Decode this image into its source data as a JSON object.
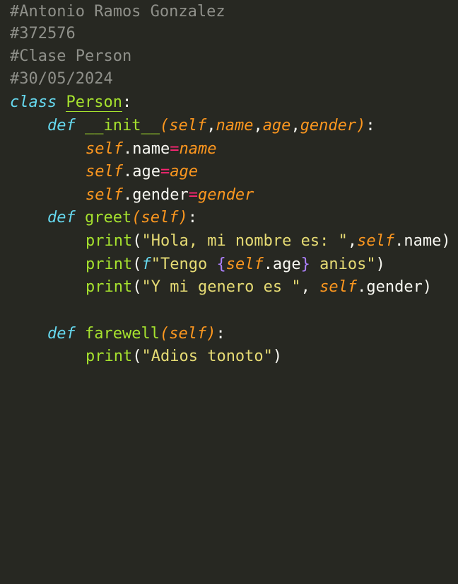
{
  "lines": {
    "l1": {
      "c": "#Antonio Ramos Gonzalez"
    },
    "l2": {
      "c": "#372576"
    },
    "l3": {
      "c": "#Clase Person"
    },
    "l4": {
      "c": "#30/05/2024"
    },
    "l5": {
      "kw": "class",
      "sp": " ",
      "name": "Person",
      "colon": ":"
    },
    "l6": {
      "kw": "def",
      "sp": " ",
      "fn": "__init__",
      "p1": "(",
      "self": "self",
      "c1": ",",
      "name": "name",
      "c2": ",",
      "age": "age",
      "c3": ",",
      "gender": "gender",
      "p2": ")",
      "colon": ":"
    },
    "l7": {
      "self": "self",
      "attr": ".name",
      "eq": "=",
      "val": "name"
    },
    "l8": {
      "self": "self",
      "attr": ".age",
      "eq": "=",
      "val": "age"
    },
    "l9": {
      "self": "self",
      "attr": ".gender",
      "eq": "=",
      "val": "gender"
    },
    "l10": {
      "kw": "def",
      "sp": " ",
      "fn": "greet",
      "p1": "(",
      "self": "self",
      "p2": ")",
      "colon": ":"
    },
    "l11": {
      "fn": "print",
      "p1": "(",
      "str": "\"Hola, mi nombre es: \"",
      "c1": ",",
      "self": "self",
      "attr": ".name",
      "p2": ")"
    },
    "l12": {
      "fn": "print",
      "p1": "(",
      "f": "f",
      "s1": "\"Tengo ",
      "b1": "{",
      "self": "self",
      "attr": ".age",
      "b2": "}",
      "s2": " anios\"",
      "p2": ")"
    },
    "l13": {
      "fn": "print",
      "p1": "(",
      "str": "\"Y mi genero es \"",
      "c1": ", ",
      "self": "self",
      "attr": ".gender",
      "p2": ")"
    },
    "l15": {
      "kw": "def",
      "sp": " ",
      "fn": "farewell",
      "p1": "(",
      "self": "self",
      "p2": ")",
      "colon": ":"
    },
    "l16": {
      "fn": "print",
      "p1": "(",
      "str": "\"Adios tonoto\"",
      "p2": ")"
    }
  }
}
